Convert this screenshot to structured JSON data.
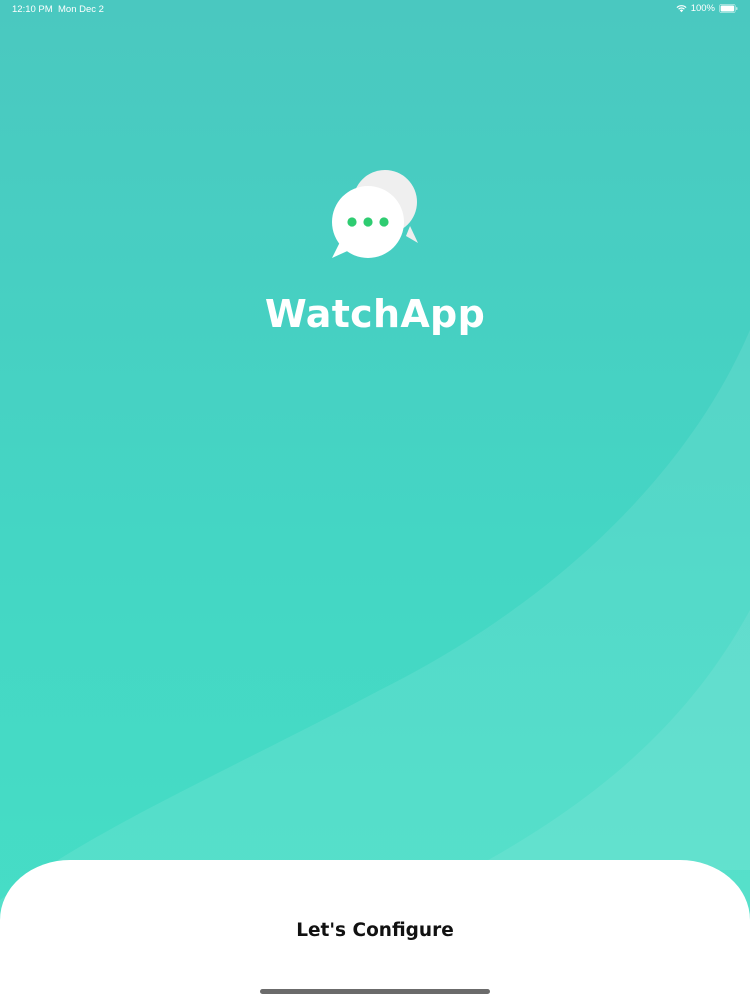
{
  "status_bar": {
    "time": "12:10 PM",
    "date": "Mon Dec 2",
    "battery": "100%",
    "wifi_icon": "wifi-icon",
    "battery_icon": "battery-icon"
  },
  "app": {
    "title": "WatchApp",
    "logo_icon": "chat-bubbles-icon"
  },
  "bottom_sheet": {
    "configure_label": "Let's Configure"
  },
  "colors": {
    "background_teal": "#44d6c4",
    "logo_dots": "#2ecc71",
    "sheet": "#ffffff",
    "button_text": "#111111"
  }
}
